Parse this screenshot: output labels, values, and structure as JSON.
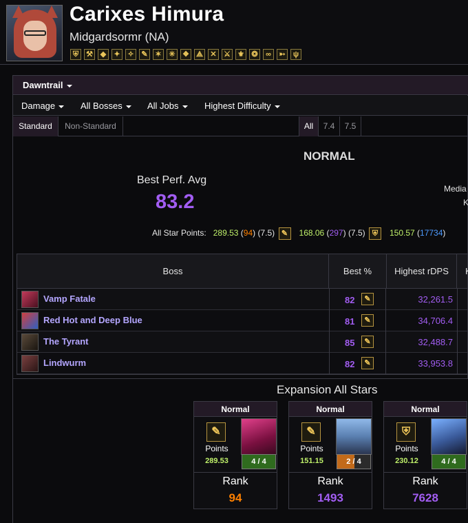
{
  "character": {
    "name": "Carixes Himura",
    "server": "Midgardsormr (NA)"
  },
  "job_icons": [
    "paladin-icon",
    "warrior-icon",
    "darkknight-icon",
    "gunbreaker-icon",
    "whitemage-icon",
    "scholar-icon",
    "astrologian-icon",
    "sage-icon",
    "monk-icon",
    "dragoon-icon",
    "ninja-icon",
    "samurai-icon",
    "reaper-icon",
    "viper-icon",
    "bard-icon",
    "machinist-icon",
    "dancer-icon"
  ],
  "filters": {
    "expansion": "Dawntrail",
    "metric": "Damage",
    "bosses": "All Bosses",
    "jobs": "All Jobs",
    "difficulty": "Highest Difficulty"
  },
  "toggles": {
    "standard": "Standard",
    "non_standard": "Non-Standard",
    "all": "All",
    "v74": "7.4",
    "v75": "7.5"
  },
  "summary": {
    "difficulty_title": "NORMAL",
    "best_perf_label": "Best Perf. Avg",
    "best_perf_value": "83.2",
    "median_label": "Media",
    "kills_label": "K",
    "all_star_label": "All Star Points:",
    "entries": [
      {
        "points": "289.53",
        "rank": "94",
        "patch": "(7.5)"
      },
      {
        "points": "168.06",
        "rank": "297",
        "patch": "(7.5)"
      },
      {
        "points": "150.57",
        "rank": "17734"
      }
    ]
  },
  "table": {
    "headers": {
      "boss": "Boss",
      "best": "Best %",
      "rdps": "Highest rDPS",
      "k": "K"
    },
    "rows": [
      {
        "boss": "Vamp Fatale",
        "best": "82",
        "rdps": "32,261.5"
      },
      {
        "boss": "Red Hot and Deep Blue",
        "best": "81",
        "rdps": "34,706.4"
      },
      {
        "boss": "The Tyrant",
        "best": "85",
        "rdps": "32,488.7"
      },
      {
        "boss": "Lindwurm",
        "best": "82",
        "rdps": "33,953.8"
      }
    ]
  },
  "all_stars": {
    "title": "Expansion All Stars",
    "cards": [
      {
        "difficulty": "Normal",
        "points_label": "Points",
        "points": "289.53",
        "progress": "4 / 4",
        "rank_label": "Rank",
        "rank": "94",
        "rank_color": "#ff8000"
      },
      {
        "difficulty": "Normal",
        "points_label": "Points",
        "points": "151.15",
        "progress": "2 / 4",
        "rank_label": "Rank",
        "rank": "1493",
        "rank_color": "#a25df2"
      },
      {
        "difficulty": "Normal",
        "points_label": "Points",
        "points": "230.12",
        "progress": "4 / 4",
        "rank_label": "Rank",
        "rank": "7628",
        "rank_color": "#a25df2"
      }
    ]
  }
}
